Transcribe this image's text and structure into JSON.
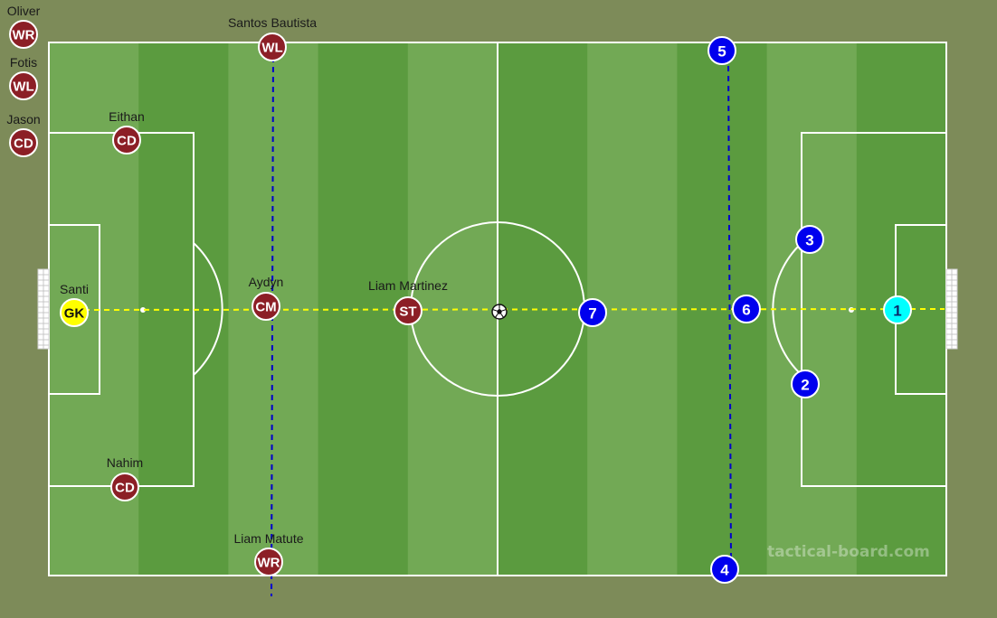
{
  "colors": {
    "background": "#7d8b59",
    "stripe_light": "#72a955",
    "stripe_dark": "#5b9b3f",
    "lines": "#ffffff",
    "team_a": "#8c1f26",
    "team_a_keeper": "#ffff00",
    "team_b": "#0000ee",
    "team_b_keeper": "#00ffff",
    "link_line_yellow": "#ffff00",
    "link_line_blue": "#0000cc"
  },
  "watermark": "tactical-board.com",
  "bench": [
    {
      "name": "Oliver",
      "role": "WR"
    },
    {
      "name": "Fotis",
      "role": "WL"
    },
    {
      "name": "Jason",
      "role": "CD"
    }
  ],
  "team_a": [
    {
      "name": "Santos Bautista",
      "role": "WL"
    },
    {
      "name": "Eithan",
      "role": "CD"
    },
    {
      "name": "Santi",
      "role": "GK",
      "keeper": true
    },
    {
      "name": "Aydyn",
      "role": "CM"
    },
    {
      "name": "Liam Martinez",
      "role": "ST"
    },
    {
      "name": "Nahim",
      "role": "CD"
    },
    {
      "name": "Liam Matute",
      "role": "WR"
    }
  ],
  "team_b": [
    {
      "number": "5"
    },
    {
      "number": "3"
    },
    {
      "number": "7"
    },
    {
      "number": "6"
    },
    {
      "number": "1",
      "keeper": true
    },
    {
      "number": "2"
    },
    {
      "number": "4"
    }
  ],
  "ball": {
    "icon": "soccer-ball-icon"
  }
}
